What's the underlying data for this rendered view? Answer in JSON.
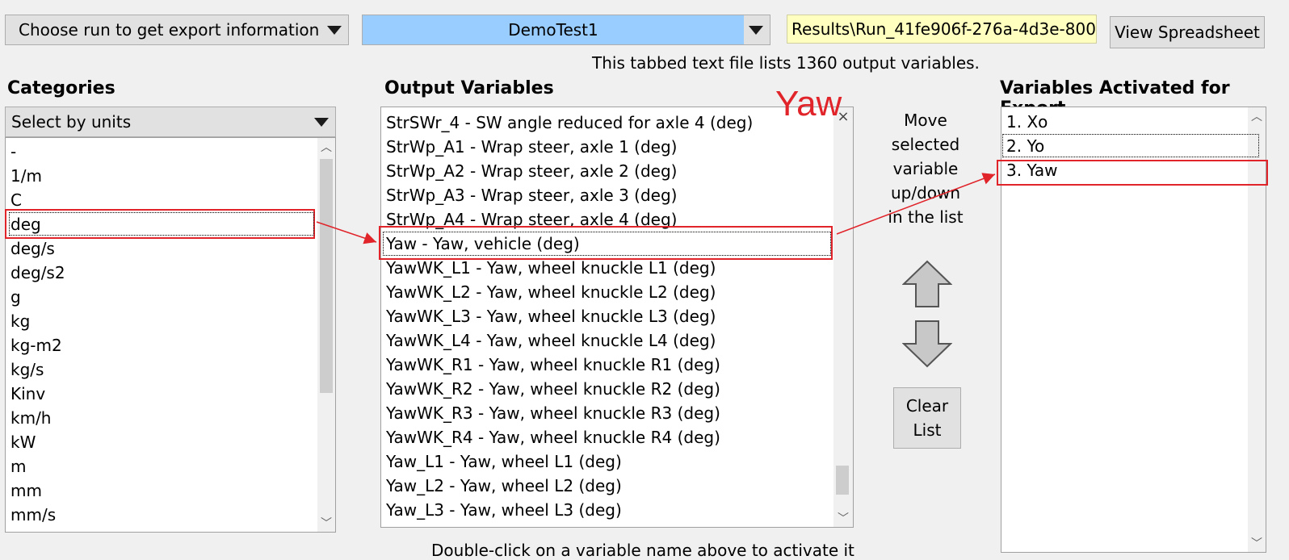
{
  "toolbar": {
    "run_select_label": "Choose run to get export information",
    "dataset_value": "DemoTest1",
    "path_value": "Results\\Run_41fe906f-276a-4d3e-800",
    "view_button": "View Spreadsheet",
    "info_text": "This tabbed text file lists 1360 output variables.",
    "dataset_color": "#99ccff",
    "path_bg_color": "#ffffc0"
  },
  "categories": {
    "heading": "Categories",
    "select_value": "Select by units",
    "items": [
      "-",
      "1/m",
      "C",
      "deg",
      "deg/s",
      "deg/s2",
      "g",
      "kg",
      "kg-m2",
      "kg/s",
      "Kinv",
      "km/h",
      "kW",
      "m",
      "mm",
      "mm/s"
    ],
    "selected": "deg"
  },
  "output": {
    "heading": "Output Variables",
    "annotation": "Yaw",
    "items": [
      "StrSWr_4 - SW angle reduced for axle 4 (deg)",
      "StrWp_A1 - Wrap steer, axle 1 (deg)",
      "StrWp_A2 - Wrap steer, axle 2 (deg)",
      "StrWp_A3 - Wrap steer, axle 3 (deg)",
      "StrWp_A4 - Wrap steer, axle 4 (deg)",
      "Yaw - Yaw, vehicle (deg)",
      "YawWK_L1 - Yaw, wheel knuckle L1 (deg)",
      "YawWK_L2 - Yaw, wheel knuckle L2 (deg)",
      "YawWK_L3 - Yaw, wheel knuckle L3 (deg)",
      "YawWK_L4 - Yaw, wheel knuckle L4 (deg)",
      "YawWK_R1 - Yaw, wheel knuckle R1 (deg)",
      "YawWK_R2 - Yaw, wheel knuckle R2 (deg)",
      "YawWK_R3 - Yaw, wheel knuckle R3 (deg)",
      "YawWK_R4 - Yaw, wheel knuckle R4 (deg)",
      "Yaw_L1 - Yaw, wheel L1 (deg)",
      "Yaw_L2 - Yaw, wheel L2 (deg)",
      "Yaw_L3 - Yaw, wheel L3 (deg)"
    ],
    "hint": "Double-click on a variable name above to activate it"
  },
  "move": {
    "line1": "Move",
    "line2": "selected",
    "line3": "variable",
    "line4": "up/down",
    "line5": "in the list",
    "clear_line1": "Clear",
    "clear_line2": "List"
  },
  "activated": {
    "heading": "Variables Activated for Export",
    "items": [
      "1. Xo",
      "2. Yo",
      "3. Yaw"
    ]
  },
  "colors": {
    "highlight": "#e0242a",
    "annotation": "#e0242a"
  }
}
